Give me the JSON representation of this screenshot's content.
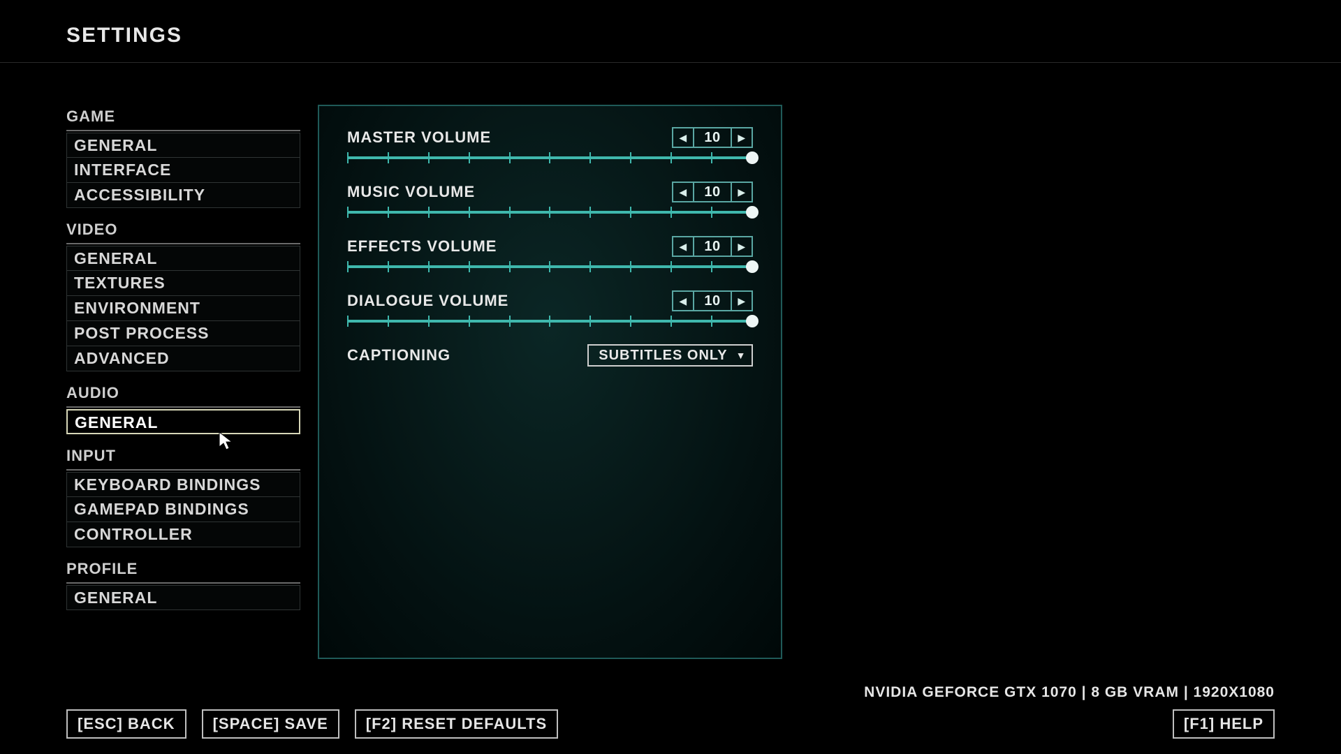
{
  "title": "SETTINGS",
  "sidebar": {
    "sections": [
      {
        "label": "GAME",
        "items": [
          "GENERAL",
          "INTERFACE",
          "ACCESSIBILITY"
        ]
      },
      {
        "label": "VIDEO",
        "items": [
          "GENERAL",
          "TEXTURES",
          "ENVIRONMENT",
          "POST PROCESS",
          "ADVANCED"
        ]
      },
      {
        "label": "AUDIO",
        "items": [
          "GENERAL"
        ],
        "selected_index": 0
      },
      {
        "label": "INPUT",
        "items": [
          "KEYBOARD BINDINGS",
          "GAMEPAD BINDINGS",
          "CONTROLLER"
        ]
      },
      {
        "label": "PROFILE",
        "items": [
          "GENERAL"
        ]
      }
    ]
  },
  "options": {
    "sliders": [
      {
        "label": "MASTER VOLUME",
        "value": "10",
        "max": 10
      },
      {
        "label": "MUSIC VOLUME",
        "value": "10",
        "max": 10
      },
      {
        "label": "EFFECTS VOLUME",
        "value": "10",
        "max": 10
      },
      {
        "label": "DIALOGUE VOLUME",
        "value": "10",
        "max": 10
      }
    ],
    "captioning": {
      "label": "CAPTIONING",
      "value": "SUBTITLES ONLY"
    }
  },
  "gpu_info": "NVIDIA GEFORCE GTX 1070 | 8 GB VRAM | 1920X1080",
  "footer": {
    "back": "[ESC] BACK",
    "save": "[SPACE] SAVE",
    "reset": "[F2] RESET DEFAULTS",
    "help": "[F1] HELP"
  }
}
